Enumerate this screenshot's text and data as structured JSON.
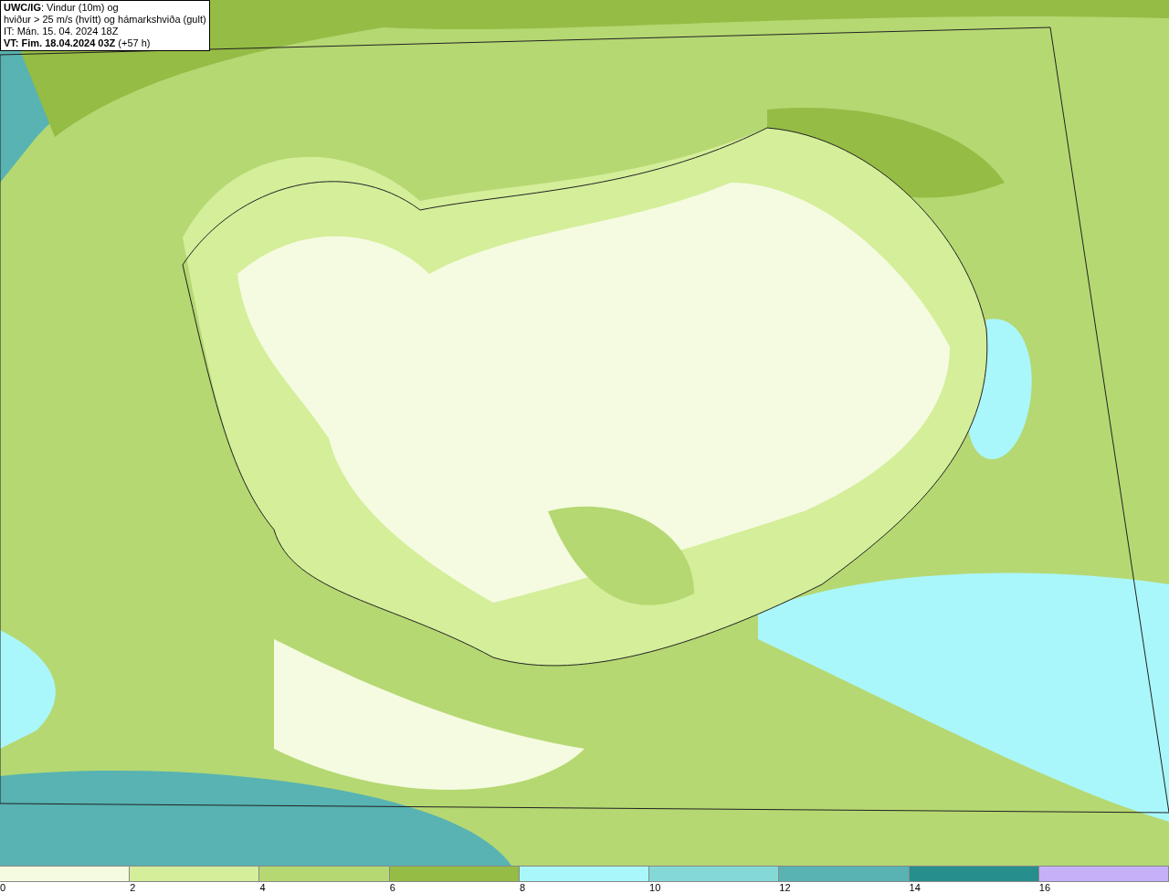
{
  "title_box": {
    "lines": [
      "**UWC/IG**: Vindur (10m) og",
      "hviður > 25 m/s (hvítt) og hámarkshviða (gult)",
      "IT: Mán. 15. 04. 2024 18Z",
      "**VT: Fim. 18.04.2024 03Z** (+57 h)"
    ]
  },
  "legend": {
    "bins": [
      {
        "color": "#f5fbe0"
      },
      {
        "color": "#d4ee9a"
      },
      {
        "color": "#b5d872"
      },
      {
        "color": "#95bc45"
      },
      {
        "color": "#aaf7fb"
      },
      {
        "color": "#84d9d6"
      },
      {
        "color": "#58b3b2"
      },
      {
        "color": "#268f8d"
      },
      {
        "color": "#c4b1f8"
      }
    ],
    "labels": [
      "0",
      "2",
      "4",
      "6",
      "8",
      "10",
      "12",
      "14",
      "16"
    ]
  }
}
